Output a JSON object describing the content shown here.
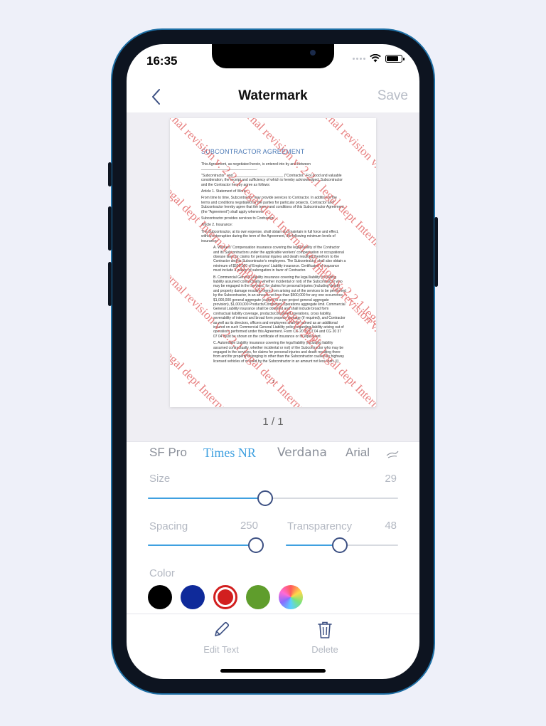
{
  "status_bar": {
    "time": "16:35"
  },
  "nav": {
    "title": "Watermark",
    "save_label": "Save"
  },
  "document": {
    "title": "SUBCONTRACTOR AGREEMENT",
    "paragraphs": [
      "This Agreement, as negotiated herein, is entered into by and between ____________________________.",
      "\"Subcontractor\" and _________________________ (\"Contractor.\" For good and valuable consideration, the receipt and sufficiency of which is hereby acknowledged, Subcontractor and the Contractor hereby agree as follows:",
      "Article 1. Statement of Work:",
      "From time to time, Subcontractor may provide services to Contractor. In addition to the terms and conditions negotiated by the parties for particular projects, Contractor and Subcontractor hereby agree that the terms and conditions of this Subcontractor Agreement (the \"Agreement\") shall apply whenever",
      "Subcontractor provides services to Contractor.",
      "Article 2. Insurance:",
      "The Subcontractor, at its own expense, shall obtain and maintain in full force and effect, without interruption during the term of the Agreement, the following minimum levels of insurance:"
    ],
    "indented_paragraphs": [
      "A. Workers' Compensation insurance covering the legal liability of the Contractor and its Subcontractors under the applicable workers' compensation or occupational disease laws for claims for personal injuries and death resulting therefrom to the Contractor and its Subcontractor's employees. The Subcontractor shall also obtain a minimum of $500,000 of Employers' Liability insurance. Certificates of insurance must include a waiver of subrogation in favor of Contractor.",
      "B. Commercial General Liability insurance covering the legal liability (including liability assumed contractually, whether incidental or not) of the Subcontractor who may be engaged in the services, for claims for personal injuries (including death) and property damage resulting there from arising out of the services to be performed by the Subcontractor, in an amount not less than $500,000 for any one occurrence, $1,000,000 general aggregate (subject to a per project general aggregate provision), $1,000,000 Products/Completed Operations aggregate limit. Commercial General Liability insurance shall be obtained and shall include broad form contractual liability coverage, products/completed operations, cross liability, severability of interest and broad form property damage (if required), and Contractor as well as its directors, officers and employees shall be named as an additional insured on such Commercial General Liability policy regarding liability arising out of operations performed under this Agreement. Form CG 20 10 07 04 and CG 20 37 07 04 must be shown on the certificate of insurance or its equivalent.",
      "C. Automobile Liability insurance covering the legal liability (including liability assumed contractually, whether incidental or not) of the Subcontractor who may be engaged in the services, for claims for personal injuries and death resulting there from and for property belonging to other than the Subcontractor caused by highway licensed vehicles of or used by the Subcontractor in an amount not less than: (i)"
    ],
    "page_number": "1",
    "watermark_text": "Internal revision v. 2.2.1 legal dept",
    "watermark_color": "#e36a6a"
  },
  "pager": {
    "label": "1 / 1"
  },
  "fonts": [
    "SF Pro",
    "Times NR",
    "Verdana",
    "Arial"
  ],
  "selected_font": "Times NR",
  "controls": {
    "size": {
      "label": "Size",
      "value": "29",
      "fraction": 0.47
    },
    "spacing": {
      "label": "Spacing",
      "value": "250",
      "fraction": 0.95
    },
    "transparency": {
      "label": "Transparency",
      "value": "48",
      "fraction": 0.48
    }
  },
  "color": {
    "label": "Color",
    "swatches": [
      "#000000",
      "#0f2a9a",
      "#d21f1f",
      "#5f9d2c",
      "rainbow"
    ],
    "selected": "#d21f1f"
  },
  "toolbar": {
    "edit_label": "Edit Text",
    "delete_label": "Delete"
  }
}
